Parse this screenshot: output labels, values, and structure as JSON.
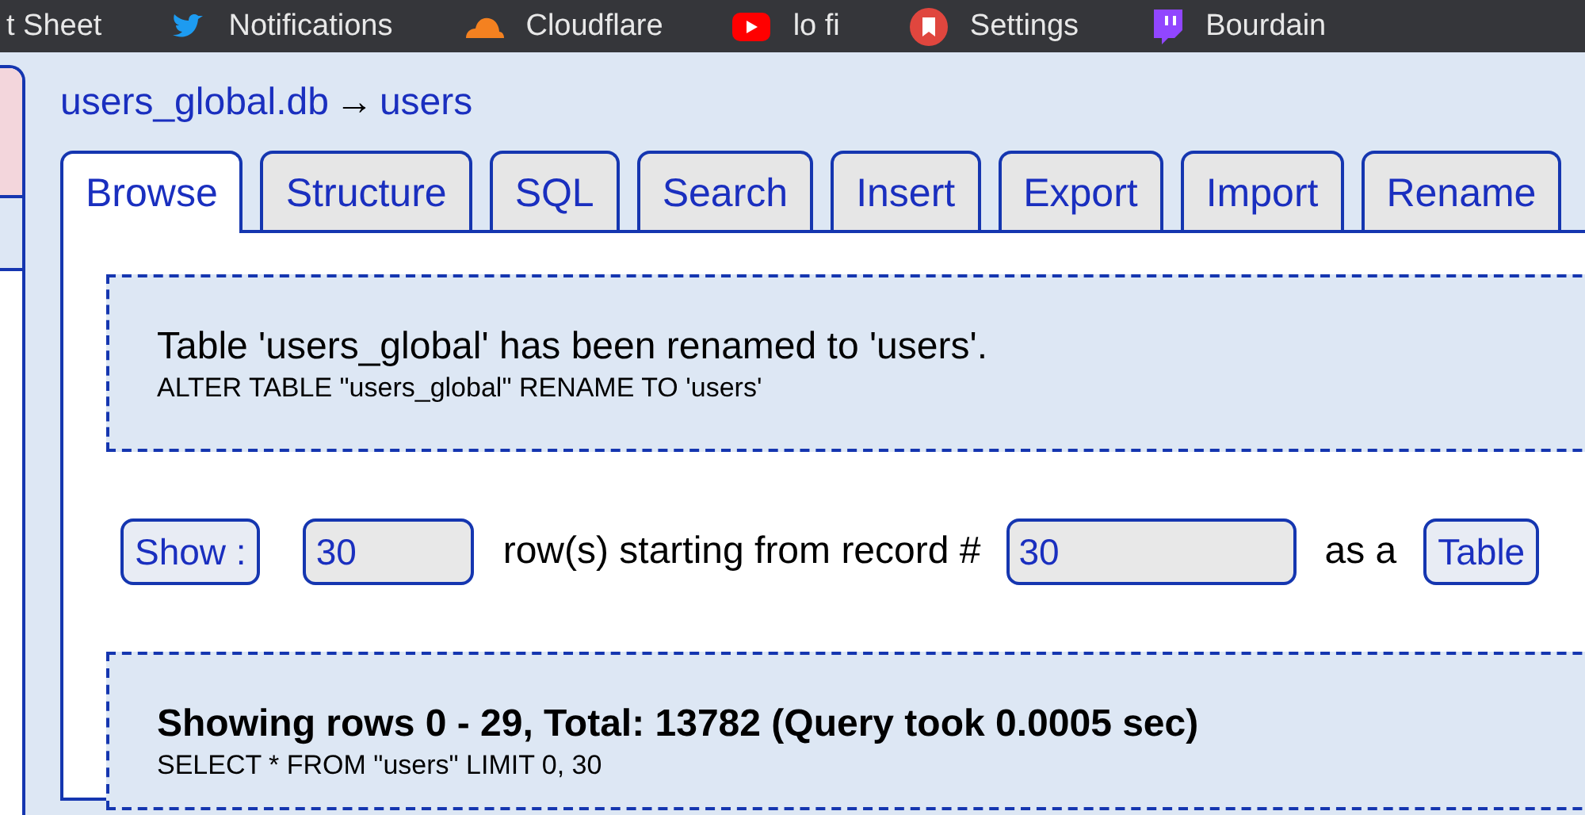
{
  "bookmarks": [
    {
      "label": "t Sheet",
      "kind": "none"
    },
    {
      "label": "Notifications",
      "kind": "bird"
    },
    {
      "label": "Cloudflare",
      "kind": "cloud"
    },
    {
      "label": "lo fi",
      "kind": "video"
    },
    {
      "label": "Settings",
      "kind": "badge"
    },
    {
      "label": "Bourdain",
      "kind": "chat"
    }
  ],
  "breadcrumb": {
    "database": "users_global.db",
    "arrow": "→",
    "table": "users"
  },
  "tabs": [
    {
      "label": "Browse",
      "selected": true
    },
    {
      "label": "Structure",
      "selected": false
    },
    {
      "label": "SQL",
      "selected": false
    },
    {
      "label": "Search",
      "selected": false
    },
    {
      "label": "Insert",
      "selected": false
    },
    {
      "label": "Export",
      "selected": false
    },
    {
      "label": "Import",
      "selected": false
    },
    {
      "label": "Rename",
      "selected": false
    }
  ],
  "message": {
    "text": "Table 'users_global' has been renamed to 'users'.",
    "query": "ALTER TABLE \"users_global\" RENAME TO 'users'"
  },
  "controls": {
    "show_button": "Show :",
    "rows": "30",
    "rows_label": "row(s) starting from record #",
    "start": "30",
    "as_label": "as a",
    "mode_button": "Table"
  },
  "result": {
    "summary": "Showing rows 0 - 29, Total: 13782 (Query took 0.0005 sec)",
    "query": "SELECT * FROM \"users\" LIMIT 0, 30"
  }
}
